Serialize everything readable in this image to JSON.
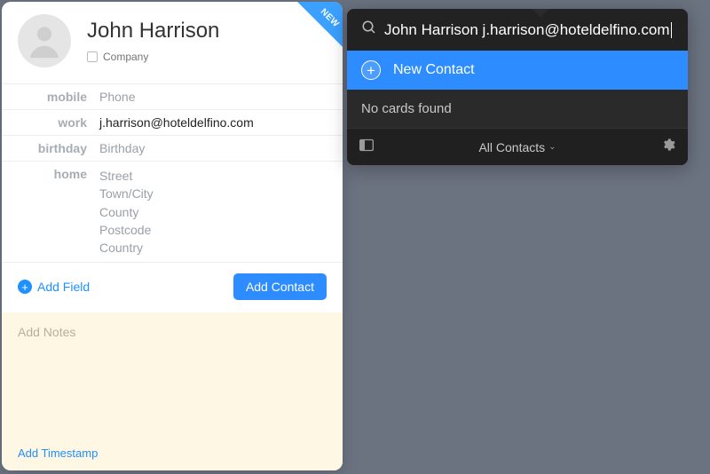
{
  "card": {
    "new_badge": "NEW",
    "full_name": "John Harrison",
    "company_label": "Company",
    "fields": {
      "mobile": {
        "label": "mobile",
        "placeholder": "Phone"
      },
      "work": {
        "label": "work",
        "value": "j.harrison@hoteldelfino.com"
      },
      "birthday": {
        "label": "birthday",
        "placeholder": "Birthday"
      },
      "home": {
        "label": "home",
        "placeholders": {
          "street": "Street",
          "city": "Town/City",
          "county": "County",
          "postcode": "Postcode",
          "country": "Country"
        }
      }
    },
    "add_field_label": "Add Field",
    "add_contact_label": "Add Contact",
    "notes_placeholder": "Add Notes",
    "add_timestamp_label": "Add Timestamp"
  },
  "search": {
    "query": "John Harrison j.harrison@hoteldelfino.com",
    "new_contact_label": "New Contact",
    "no_results_label": "No cards found",
    "list_label": "All Contacts"
  },
  "colors": {
    "accent": "#2d8cff",
    "ribbon": "#3ba0ff",
    "panel_dark": "#2a2a2a",
    "notes_bg": "#fdf7e3"
  }
}
